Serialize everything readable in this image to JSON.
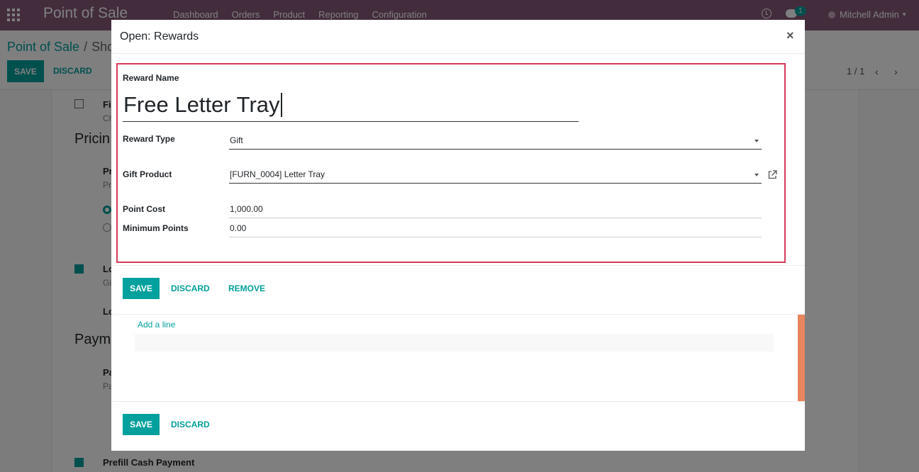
{
  "app": {
    "brand": "Point of Sale",
    "menu": [
      "Dashboard",
      "Orders",
      "Product",
      "Reporting",
      "Configuration"
    ],
    "chat_count": "1",
    "user": "Mitchell Admin"
  },
  "control_panel": {
    "breadcrumb_root": "Point of Sale",
    "breadcrumb_sep": "/",
    "breadcrumb_current": "Sho",
    "save_label": "SAVE",
    "discard_label": "DISCARD",
    "pager": "1 / 1"
  },
  "background_form": {
    "pricing_heading": "Pricin",
    "payment_heading": "Paym",
    "frag_fi": "Fi",
    "frag_ch": "Ch",
    "frag_pr": "Pr",
    "frag_pr2": "Pr",
    "frag_lo": "Lo",
    "frag_gi": "Gi",
    "frag_lo2": "Lo",
    "frag_pa": "Pa",
    "frag_pa2": "Pa",
    "prefill_label": "Prefill Cash Payment"
  },
  "modal": {
    "title": "Open: Rewards",
    "close_symbol": "×",
    "reward_name_label": "Reward Name",
    "reward_name_value": "Free Letter Tray",
    "reward_type_label": "Reward Type",
    "reward_type_value": "Gift",
    "gift_product_label": "Gift Product",
    "gift_product_value": "[FURN_0004] Letter Tray",
    "point_cost_label": "Point Cost",
    "point_cost_value": "1,000.00",
    "minimum_points_label": "Minimum Points",
    "minimum_points_value": "0.00",
    "save_label": "SAVE",
    "discard_label": "DISCARD",
    "remove_label": "REMOVE",
    "add_line_label": "Add a line",
    "outer_save_label": "SAVE",
    "outer_discard_label": "DISCARD"
  },
  "colors": {
    "brand": "#875a7b",
    "accent": "#00a09d",
    "highlight_border": "#d63a5a",
    "side_bar": "#e8855e"
  },
  "icons": [
    "apps-grid-icon",
    "clock-icon",
    "chat-icon",
    "chevron-left-icon",
    "chevron-right-icon",
    "external-link-icon",
    "close-icon",
    "dropdown-caret-icon"
  ]
}
